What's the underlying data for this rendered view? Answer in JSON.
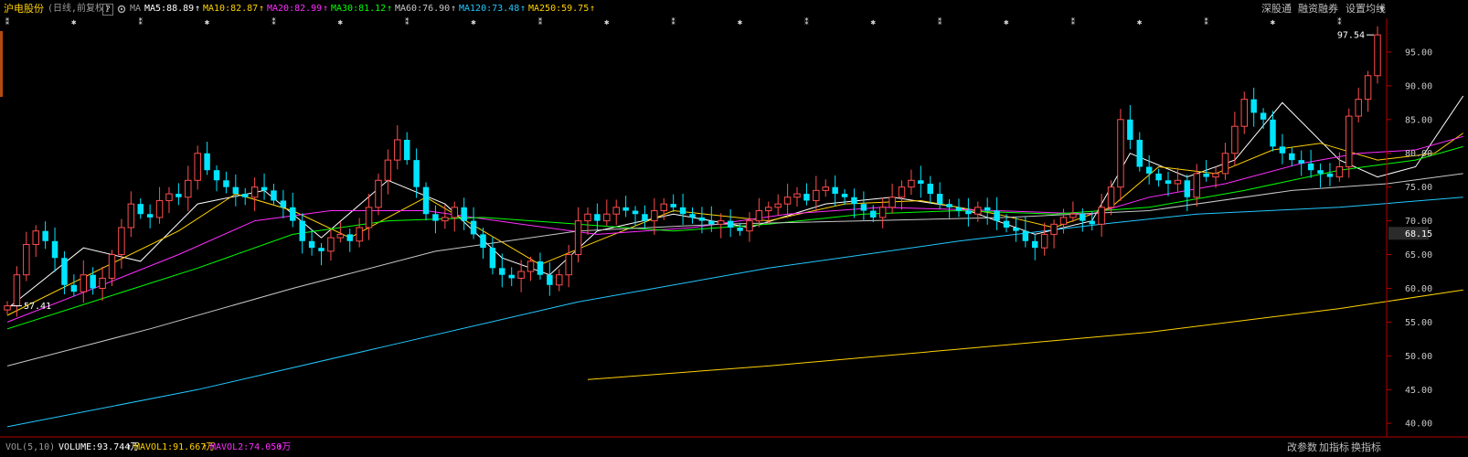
{
  "header": {
    "stock_name": "沪电股份",
    "period_label": "(日线,前复权)",
    "help_label": "?",
    "ma_label": "MA",
    "ma_values": [
      {
        "text": "MA5:88.89",
        "color": "#ffffff"
      },
      {
        "text": "MA10:82.87",
        "color": "#ffd200"
      },
      {
        "text": "MA20:82.99",
        "color": "#ff2dff"
      },
      {
        "text": "MA30:81.12",
        "color": "#00ff00"
      },
      {
        "text": "MA60:76.90",
        "color": "#c8c8c8"
      },
      {
        "text": "MA120:73.48",
        "color": "#22c8ff"
      },
      {
        "text": "MA250:59.75",
        "color": "#ffd200"
      }
    ],
    "menu": [
      "深股通",
      "融资融券",
      "设置均线"
    ]
  },
  "footer": {
    "vol_label": "VOL(5,10)",
    "volume": "VOLUME:93.744万",
    "mavol1": "MAVOL1:91.667万",
    "mavol2": "MAVOL2:74.050万",
    "buttons": [
      "改参数",
      "加指标",
      "换指标"
    ]
  },
  "icons": [
    "gear-icon",
    "up-arrow-icon",
    "info-marker-icon",
    "chevron-down-icon"
  ],
  "colors": {
    "up": "#ff4d4d",
    "down": "#00e5ff",
    "ma5": "#ffffff",
    "ma10": "#ffd200",
    "ma20": "#ff2dff",
    "ma30": "#00ff00",
    "ma60": "#c8c8c8",
    "ma120": "#22c8ff",
    "ma250": "#ffd200",
    "axis": "#b40000"
  },
  "chart_data": {
    "type": "candlestick",
    "ylim": [
      38,
      100
    ],
    "yticks": [
      "95.00",
      "90.00",
      "85.00",
      "80.00",
      "75.00",
      "70.00",
      "65.00",
      "60.00",
      "55.00",
      "50.00",
      "45.00",
      "40.00"
    ],
    "last_price": "68.15",
    "high_label": "97.54",
    "low_label": "57.41",
    "n_bars": 137,
    "closes": [
      57.41,
      62.0,
      66.5,
      68.5,
      67.0,
      64.5,
      60.5,
      59.5,
      62.0,
      60.0,
      61.5,
      65.0,
      69.0,
      72.5,
      71.0,
      70.5,
      73.0,
      74.0,
      73.5,
      76.0,
      80.0,
      77.5,
      76.0,
      75.0,
      74.0,
      73.5,
      75.0,
      74.5,
      73.0,
      72.0,
      70.0,
      67.0,
      66.0,
      65.5,
      67.5,
      68.0,
      67.0,
      69.0,
      72.0,
      76.0,
      79.0,
      82.0,
      79.0,
      75.0,
      71.0,
      70.0,
      70.5,
      72.0,
      70.0,
      68.0,
      66.0,
      63.0,
      62.0,
      61.5,
      62.5,
      64.0,
      62.0,
      60.5,
      62.0,
      65.0,
      70.0,
      71.0,
      70.0,
      71.0,
      72.0,
      71.5,
      71.0,
      70.0,
      71.5,
      72.5,
      72.0,
      71.0,
      70.5,
      70.0,
      69.5,
      70.0,
      69.0,
      68.5,
      70.0,
      71.5,
      72.0,
      72.5,
      73.5,
      74.0,
      73.0,
      74.5,
      75.0,
      74.0,
      73.5,
      72.5,
      71.5,
      70.5,
      72.0,
      73.5,
      75.0,
      76.0,
      75.5,
      74.0,
      72.5,
      72.0,
      71.5,
      71.0,
      72.0,
      71.5,
      70.0,
      69.0,
      68.5,
      67.0,
      66.0,
      68.0,
      69.5,
      70.5,
      71.0,
      70.0,
      69.5,
      72.0,
      75.0,
      85.0,
      82.0,
      78.0,
      77.0,
      76.0,
      75.5,
      76.0,
      73.5,
      77.0,
      76.5,
      77.0,
      80.0,
      84.0,
      88.0,
      86.0,
      85.0,
      81.0,
      80.0,
      79.0,
      78.5,
      77.5,
      77.0,
      76.5,
      78.0,
      85.5,
      88.0,
      91.5,
      97.54
    ],
    "series": [
      {
        "name": "MA5",
        "color_key": "ma5",
        "points": [
          [
            0,
            57.0
          ],
          [
            8,
            66.0
          ],
          [
            14,
            64.0
          ],
          [
            20,
            72.5
          ],
          [
            27,
            74.5
          ],
          [
            33,
            67.5
          ],
          [
            40,
            76.0
          ],
          [
            46,
            72.5
          ],
          [
            52,
            64.5
          ],
          [
            57,
            62.0
          ],
          [
            62,
            68.5
          ],
          [
            70,
            71.0
          ],
          [
            78,
            69.0
          ],
          [
            86,
            72.5
          ],
          [
            93,
            73.5
          ],
          [
            100,
            72.0
          ],
          [
            108,
            68.0
          ],
          [
            114,
            70.0
          ],
          [
            118,
            80.0
          ],
          [
            124,
            76.5
          ],
          [
            129,
            79.0
          ],
          [
            134,
            87.5
          ],
          [
            140,
            79.0
          ],
          [
            144,
            76.5
          ],
          [
            148,
            78.0
          ],
          [
            153,
            88.5
          ]
        ]
      },
      {
        "name": "MA10",
        "color_key": "ma10",
        "points": [
          [
            0,
            56.0
          ],
          [
            10,
            63.0
          ],
          [
            18,
            68.5
          ],
          [
            24,
            74.0
          ],
          [
            30,
            71.5
          ],
          [
            36,
            67.5
          ],
          [
            44,
            73.5
          ],
          [
            50,
            68.5
          ],
          [
            56,
            63.5
          ],
          [
            62,
            67.0
          ],
          [
            70,
            71.5
          ],
          [
            80,
            70.0
          ],
          [
            88,
            72.5
          ],
          [
            96,
            73.0
          ],
          [
            104,
            71.0
          ],
          [
            110,
            69.0
          ],
          [
            116,
            72.0
          ],
          [
            121,
            78.0
          ],
          [
            127,
            77.0
          ],
          [
            133,
            80.5
          ],
          [
            138,
            81.5
          ],
          [
            144,
            79.0
          ],
          [
            150,
            80.0
          ],
          [
            153,
            83.0
          ]
        ]
      },
      {
        "name": "MA20",
        "color_key": "ma20",
        "points": [
          [
            0,
            55.0
          ],
          [
            10,
            60.5
          ],
          [
            18,
            65.0
          ],
          [
            26,
            70.0
          ],
          [
            34,
            71.5
          ],
          [
            44,
            71.5
          ],
          [
            54,
            69.5
          ],
          [
            62,
            68.0
          ],
          [
            72,
            69.0
          ],
          [
            82,
            71.0
          ],
          [
            92,
            72.0
          ],
          [
            104,
            71.5
          ],
          [
            114,
            71.0
          ],
          [
            120,
            73.5
          ],
          [
            128,
            75.5
          ],
          [
            136,
            78.5
          ],
          [
            142,
            80.0
          ],
          [
            148,
            80.5
          ],
          [
            153,
            82.5
          ]
        ]
      },
      {
        "name": "MA30",
        "color_key": "ma30",
        "points": [
          [
            0,
            54.0
          ],
          [
            10,
            58.5
          ],
          [
            20,
            63.0
          ],
          [
            30,
            68.0
          ],
          [
            40,
            70.0
          ],
          [
            50,
            70.5
          ],
          [
            60,
            69.5
          ],
          [
            70,
            68.5
          ],
          [
            80,
            69.5
          ],
          [
            90,
            71.0
          ],
          [
            100,
            71.5
          ],
          [
            110,
            71.0
          ],
          [
            120,
            72.0
          ],
          [
            130,
            74.5
          ],
          [
            140,
            77.5
          ],
          [
            148,
            79.0
          ],
          [
            153,
            81.0
          ]
        ]
      },
      {
        "name": "MA60",
        "color_key": "ma60",
        "points": [
          [
            0,
            48.5
          ],
          [
            15,
            54.0
          ],
          [
            30,
            60.0
          ],
          [
            45,
            65.5
          ],
          [
            60,
            68.5
          ],
          [
            75,
            69.5
          ],
          [
            90,
            70.0
          ],
          [
            105,
            70.5
          ],
          [
            120,
            71.5
          ],
          [
            135,
            74.5
          ],
          [
            145,
            75.5
          ],
          [
            153,
            77.0
          ]
        ]
      },
      {
        "name": "MA120",
        "color_key": "ma120",
        "points": [
          [
            0,
            39.5
          ],
          [
            20,
            45.0
          ],
          [
            40,
            51.5
          ],
          [
            60,
            58.0
          ],
          [
            80,
            63.0
          ],
          [
            100,
            67.0
          ],
          [
            115,
            69.5
          ],
          [
            125,
            71.0
          ],
          [
            140,
            72.0
          ],
          [
            153,
            73.5
          ]
        ]
      },
      {
        "name": "MA250",
        "color_key": "ma250",
        "points": [
          [
            61,
            46.5
          ],
          [
            80,
            48.5
          ],
          [
            100,
            51.0
          ],
          [
            120,
            53.5
          ],
          [
            140,
            57.0
          ],
          [
            153,
            59.75
          ]
        ]
      }
    ]
  }
}
